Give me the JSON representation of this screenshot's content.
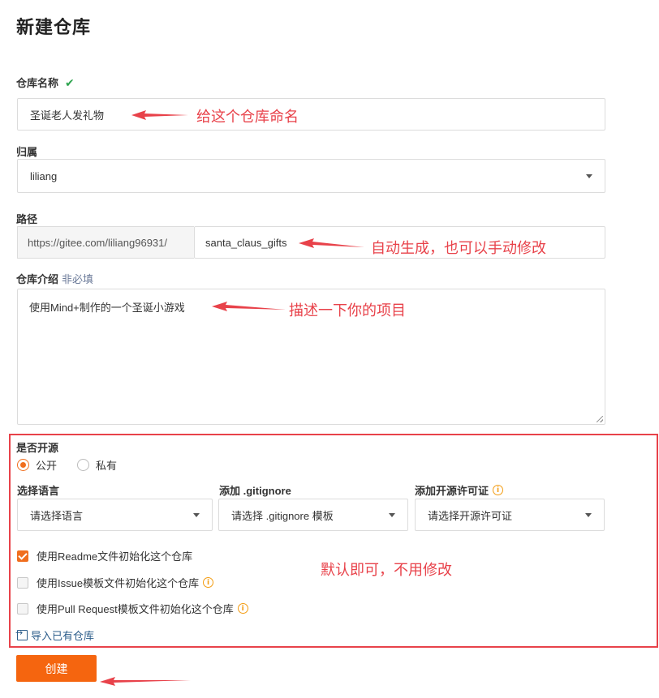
{
  "page": {
    "title": "新建仓库"
  },
  "form": {
    "name": {
      "label": "仓库名称",
      "value": "圣诞老人发礼物"
    },
    "owner": {
      "label": "归属",
      "value": "liliang"
    },
    "path": {
      "label": "路径",
      "prefix": "https://gitee.com/liliang96931/",
      "value": "santa_claus_gifts"
    },
    "description": {
      "label": "仓库介绍",
      "optional": "非必填",
      "value": "使用Mind+制作的一个圣诞小游戏"
    },
    "visibility": {
      "label": "是否开源",
      "options": [
        "公开",
        "私有"
      ],
      "selected": "公开"
    },
    "language": {
      "label": "选择语言",
      "placeholder": "请选择语言"
    },
    "gitignore": {
      "label": "添加 .gitignore",
      "placeholder": "请选择 .gitignore 模板"
    },
    "license": {
      "label": "添加开源许可证",
      "placeholder": "请选择开源许可证"
    },
    "checkboxes": [
      {
        "label": "使用Readme文件初始化这个仓库",
        "checked": true
      },
      {
        "label": "使用Issue模板文件初始化这个仓库",
        "checked": false
      },
      {
        "label": "使用Pull Request模板文件初始化这个仓库",
        "checked": false
      }
    ],
    "import_link": "导入已有仓库",
    "submit": "创建"
  },
  "annotations": {
    "name": "给这个仓库命名",
    "path": "自动生成，也可以手动修改",
    "description": "描述一下你的项目",
    "defaults": "默认即可，不用修改"
  },
  "colors": {
    "accent": "#f5650f",
    "annotation": "#e8424a",
    "link": "#2b5c8a",
    "check": "#2ea44f"
  }
}
